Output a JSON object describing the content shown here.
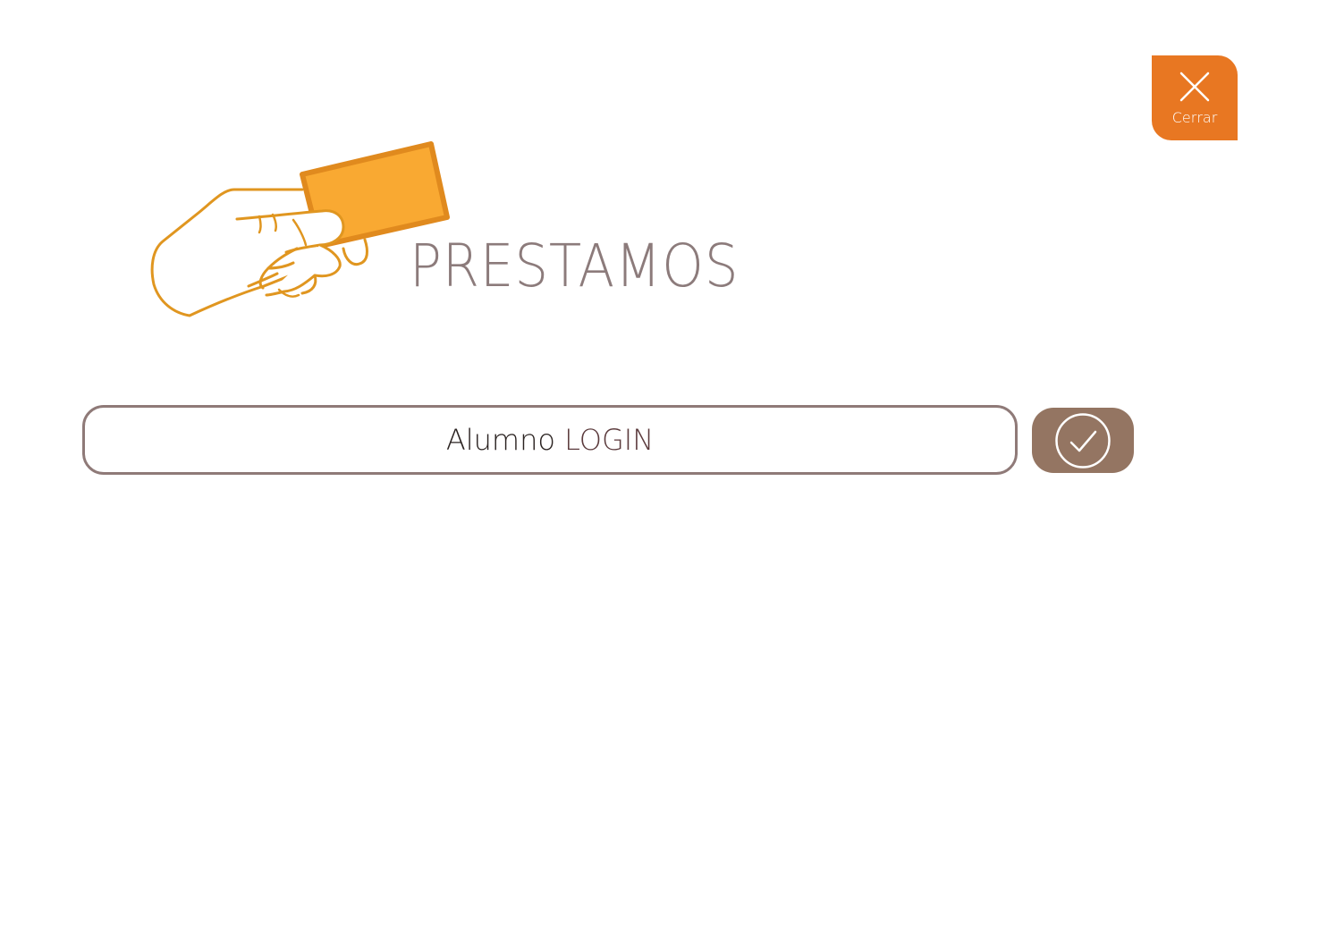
{
  "header": {
    "close_button": {
      "label": "Cerrar",
      "icon": "close-icon",
      "color": "#E87722"
    }
  },
  "hero": {
    "title": "PRESTAMOS",
    "illustration_icon": "hand-holding-card-icon",
    "title_color": "#8C7B7B",
    "accent_color": "#F9A932"
  },
  "login": {
    "field_word_1": "Alumno",
    "field_word_2": "LOGIN",
    "submit_icon": "check-circle-icon",
    "submit_color": "#947562"
  }
}
